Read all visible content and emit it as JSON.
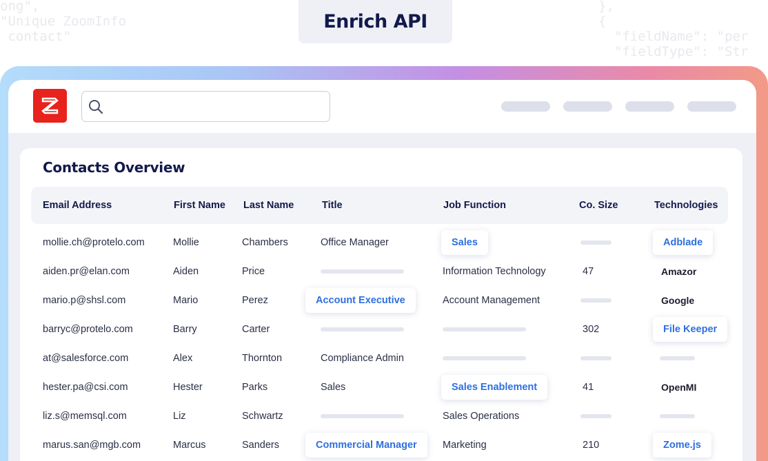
{
  "page": {
    "title": "Enrich API"
  },
  "background_code": {
    "left_lines": [
      "ong\",",
      "\"Unique ZoomInfo",
      " contact\""
    ],
    "right_lines": [
      "},",
      "{",
      "  \"fieldName\": \"per",
      "  \"fieldType\": \"Str"
    ]
  },
  "header": {
    "logo_letter": "Z",
    "search": {
      "value": "",
      "placeholder": ""
    },
    "nav_pill_count": 4
  },
  "card": {
    "title": "Contacts Overview"
  },
  "table": {
    "columns": [
      {
        "key": "email",
        "label": "Email Address"
      },
      {
        "key": "first",
        "label": "First Name"
      },
      {
        "key": "last",
        "label": "Last Name"
      },
      {
        "key": "title",
        "label": "Title"
      },
      {
        "key": "job",
        "label": "Job Function"
      },
      {
        "key": "size",
        "label": "Co. Size"
      },
      {
        "key": "tech",
        "label": "Technologies"
      }
    ],
    "rows": [
      {
        "email": "mollie.ch@protelo.com",
        "first": "Mollie",
        "last": "Chambers",
        "title": {
          "text": "Office Manager"
        },
        "job": {
          "text": "Sales",
          "chip": true
        },
        "size": {
          "placeholder": true
        },
        "tech": {
          "text": "Adblade",
          "chip": true
        }
      },
      {
        "email": "aiden.pr@elan.com",
        "first": "Aiden",
        "last": "Price",
        "title": {
          "placeholder": true
        },
        "job": {
          "text": "Information Technology"
        },
        "size": {
          "text": "47"
        },
        "tech": {
          "text": "Amazor"
        }
      },
      {
        "email": "mario.p@shsl.com",
        "first": "Mario",
        "last": "Perez",
        "title": {
          "text": "Account Executive",
          "chip": true
        },
        "job": {
          "text": "Account Management"
        },
        "size": {
          "placeholder": true
        },
        "tech": {
          "text": "Google"
        }
      },
      {
        "email": "barryc@protelo.com",
        "first": "Barry",
        "last": "Carter",
        "title": {
          "placeholder": true
        },
        "job": {
          "placeholder": true
        },
        "size": {
          "text": "302"
        },
        "tech": {
          "text": "File Keeper",
          "chip": true
        }
      },
      {
        "email": "at@salesforce.com",
        "first": "Alex",
        "last": "Thornton",
        "title": {
          "text": "Compliance Admin"
        },
        "job": {
          "placeholder": true
        },
        "size": {
          "placeholder": true
        },
        "tech": {
          "placeholder": true
        }
      },
      {
        "email": "hester.pa@csi.com",
        "first": "Hester",
        "last": "Parks",
        "title": {
          "text": "Sales"
        },
        "job": {
          "text": "Sales Enablement",
          "chip": true
        },
        "size": {
          "text": "41"
        },
        "tech": {
          "text": "OpenMI"
        }
      },
      {
        "email": "liz.s@memsql.com",
        "first": "Liz",
        "last": "Schwartz",
        "title": {
          "placeholder": true
        },
        "job": {
          "text": "Sales Operations"
        },
        "size": {
          "placeholder": true
        },
        "tech": {
          "placeholder": true
        }
      },
      {
        "email": "marus.san@mgb.com",
        "first": "Marcus",
        "last": "Sanders",
        "title": {
          "text": "Commercial Manager",
          "chip": true
        },
        "job": {
          "text": "Marketing"
        },
        "size": {
          "text": "210"
        },
        "tech": {
          "text": "Zome.js",
          "chip": true
        }
      }
    ]
  },
  "colors": {
    "brand_red": "#e8221c",
    "heading_navy": "#121a4a",
    "chip_blue": "#2e6fe0",
    "app_background": "#eef0f6",
    "placeholder_bar": "#e3e6ee"
  }
}
